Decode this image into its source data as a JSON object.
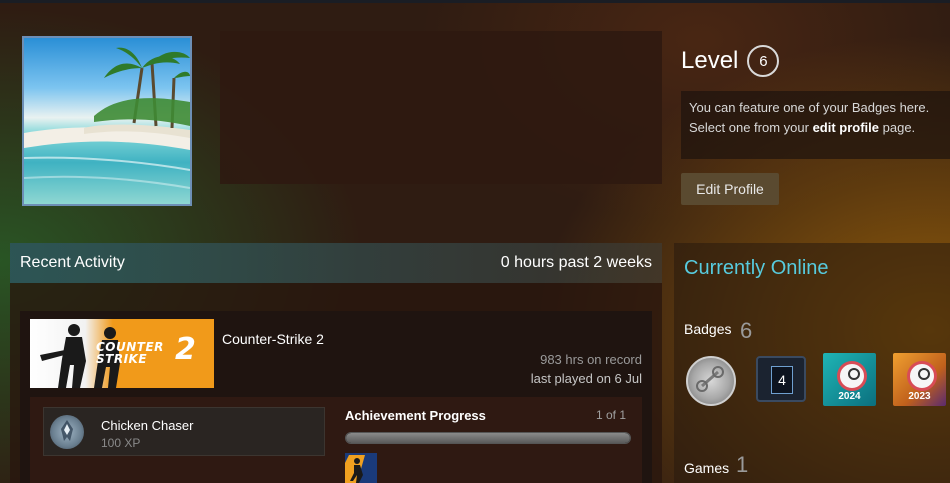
{
  "profile": {
    "level_label": "Level",
    "level_value": "6",
    "feature_text_1": "You can feature one of your Badges here.",
    "feature_text_2a": "Select one from your ",
    "feature_text_2b": "edit profile",
    "feature_text_2c": " page.",
    "edit_button": "Edit Profile"
  },
  "activity": {
    "title": "Recent Activity",
    "summary": "0 hours past 2 weeks",
    "game": {
      "capsule_text_line1": "COUNTER",
      "capsule_text_line2": "STRIKE",
      "capsule_number": "2",
      "name": "Counter-Strike 2",
      "hours": "983 hrs on record",
      "last_played": "last played on 6 Jul",
      "achievement": {
        "name": "Chicken Chaser",
        "xp": "100 XP",
        "progress_title": "Achievement Progress",
        "progress_count": "1 of 1",
        "progress_fraction": 1.0
      }
    }
  },
  "sidebar": {
    "online_status": "Currently Online",
    "badges_label": "Badges",
    "badges_count": "6",
    "badge_items": [
      {
        "name": "silver-link-badge"
      },
      {
        "name": "level-badge",
        "text": "4"
      },
      {
        "name": "steam-2024-badge",
        "text": "2024"
      },
      {
        "name": "steam-2023-badge",
        "text": "2023"
      }
    ],
    "games_label": "Games",
    "games_count": "1"
  },
  "colors": {
    "online_accent": "#57cbde",
    "background_brown": "#2f1c12",
    "button_bg": "#5a4a30"
  }
}
